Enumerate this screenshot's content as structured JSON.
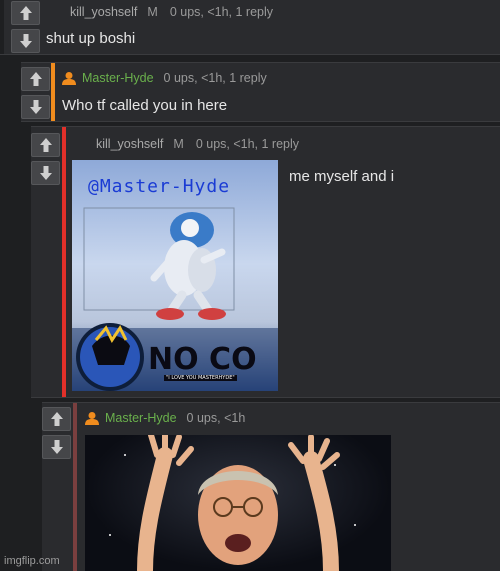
{
  "comments": [
    {
      "user": "kill_yoshself",
      "badge": "M",
      "stats": "0 ups, <1h, 1 reply",
      "text": "shut up boshi",
      "bar_color": "#1e1f21"
    },
    {
      "user": "Master-Hyde",
      "stats": "0 ups, <1h, 1 reply",
      "text": "Who tf called you in here",
      "bar_color": "#f08c1e"
    },
    {
      "user": "kill_yoshself",
      "badge": "M",
      "stats": "0 ups, <1h, 1 reply",
      "text": "me myself and i",
      "bar_color": "#e2302a",
      "image": {
        "overlay_text": "@Master-Hyde",
        "bottom_text": "NO CO",
        "small_text": "\"I LOVE YOU MASTERHYDE\""
      }
    },
    {
      "user": "Master-Hyde",
      "stats": "0 ups, <1h",
      "bar_color": "#7a3f3f"
    }
  ],
  "icons": {
    "upvote": "arrow-up-icon",
    "downvote": "arrow-down-icon",
    "avatar": "user-avatar-icon"
  },
  "accent_green": "#6ab04c",
  "watermark": "imgflip.com"
}
